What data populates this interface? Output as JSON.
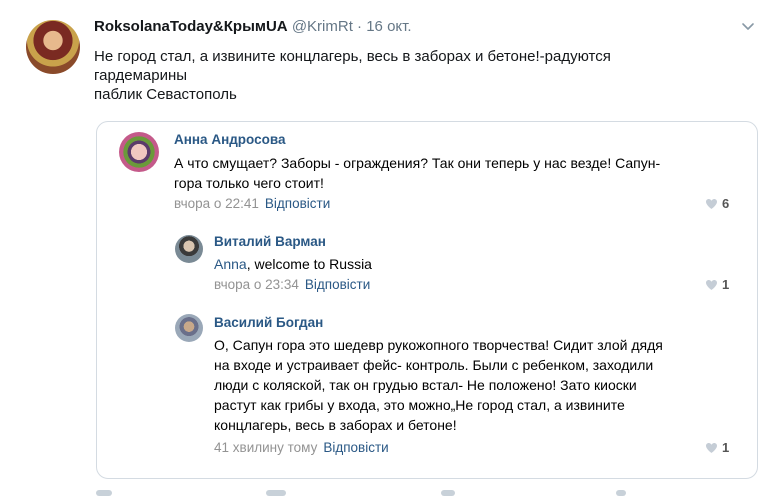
{
  "tweet": {
    "author_name": "RoksolanaToday&КрымUA",
    "handle": "@KrimRt",
    "separator": "·",
    "date": "16 окт.",
    "text_lines": [
      "Не город стал, а извините концлагерь, весь в заборах и бетоне!-радуются",
      "гардемарины",
      "паблик Севастополь"
    ],
    "menu_icon": "chevron-down-icon"
  },
  "comments": [
    {
      "author": "Анна Андросова",
      "lines": [
        "А что смущает? Заборы - ограждения? Так они теперь у нас везде! Сапун-",
        "гора только чего стоит!"
      ],
      "time": "вчора о 22:41",
      "reply": "Відповісти",
      "likes": "6"
    },
    {
      "author": "Виталий Варман",
      "mention": "Anna",
      "text_after_mention": ", welcome to Russia",
      "time": "вчора о 23:34",
      "reply": "Відповісти",
      "likes": "1"
    },
    {
      "author": "Василий Богдан",
      "lines": [
        "О, Сапун гора это шедевр рукожопного творчества! Сидит злой дядя",
        "на входе и устраивает фейс- контроль. Были с ребенком, заходили",
        "люди с коляской, так он грудью встал- Не положено! Зато киоски",
        "растут как грибы у входа, это можно„Не город стал, а извините",
        "концлагерь, весь в заборах и бетоне!"
      ],
      "time": "41 хвилину тому",
      "reply": "Відповісти",
      "likes": "1"
    }
  ],
  "colors": {
    "link": "#2a5885",
    "meta": "#939393",
    "border": "#d4dbe2"
  }
}
